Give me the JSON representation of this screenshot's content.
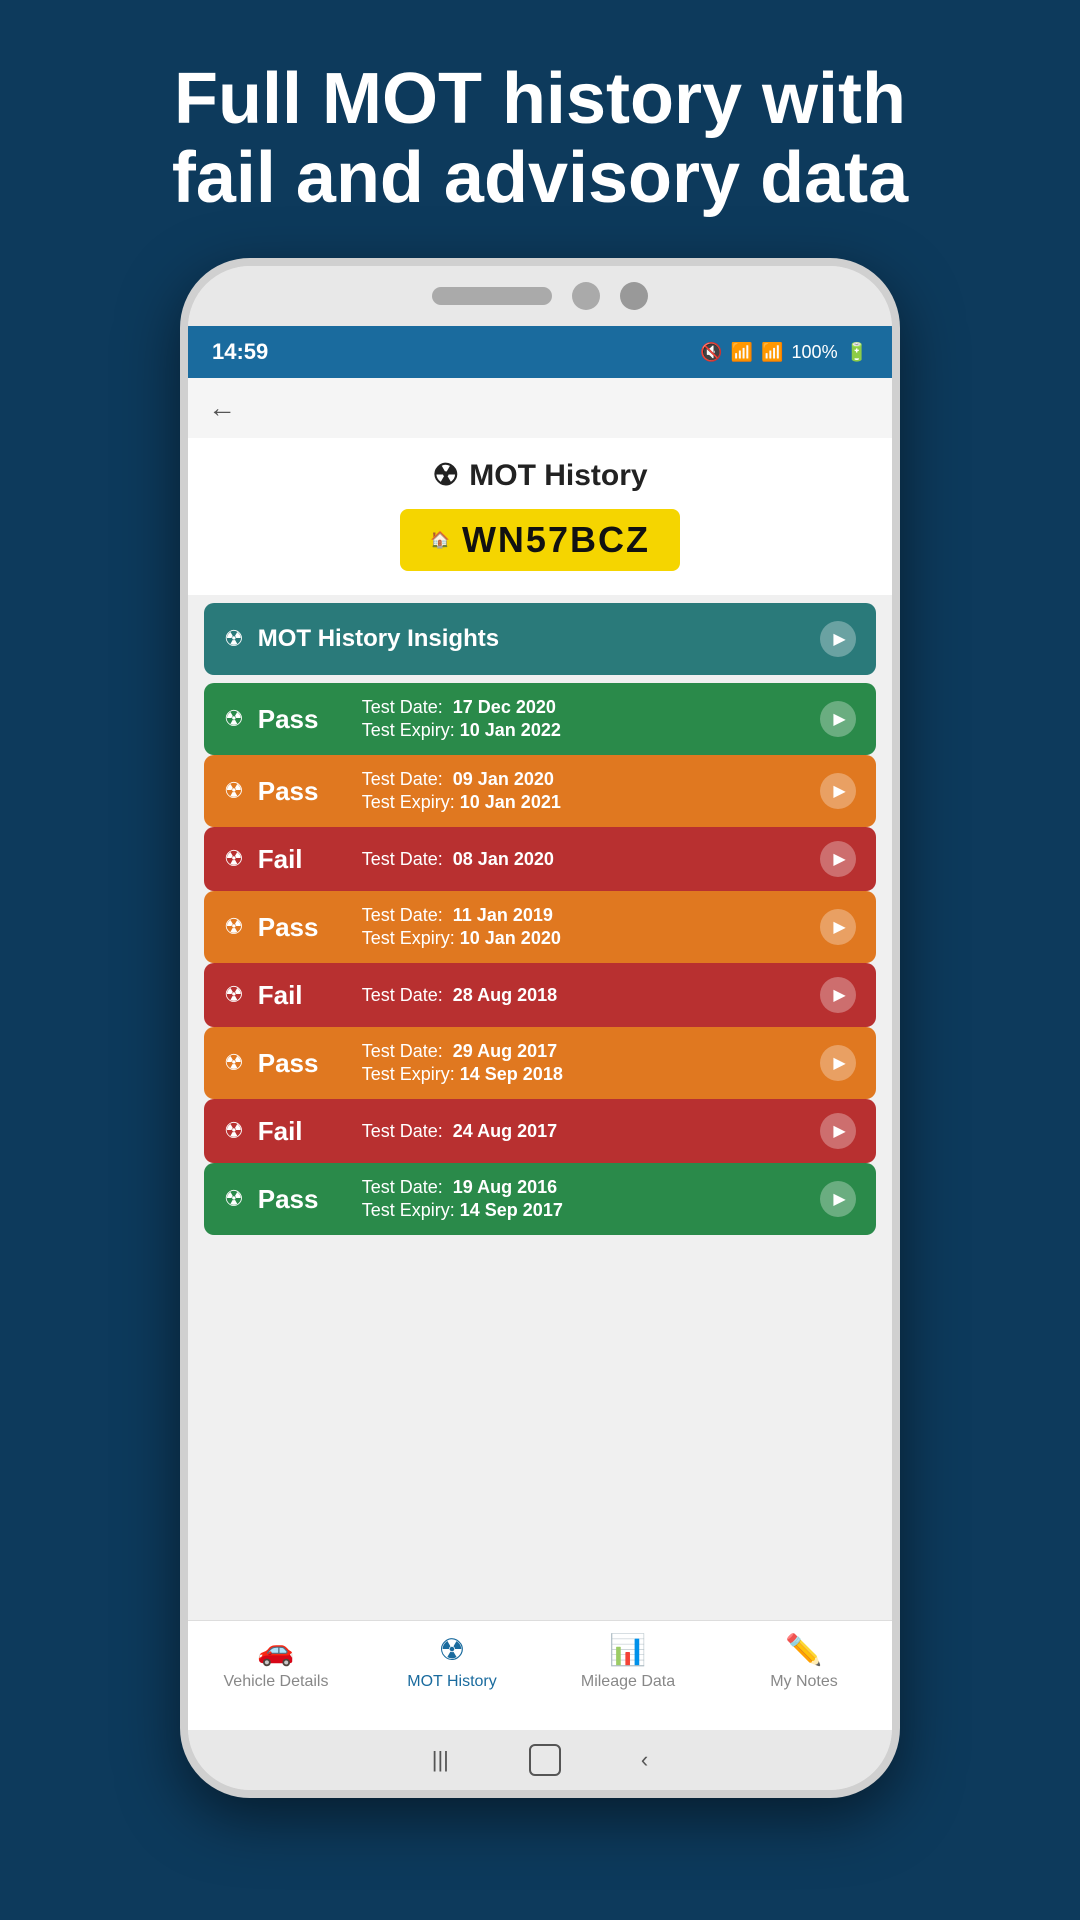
{
  "headline": {
    "line1": "Full MOT history with",
    "line2": "fail and advisory data"
  },
  "statusBar": {
    "time": "14:59",
    "battery": "100%"
  },
  "motHeader": {
    "title": "MOT History",
    "plate": "WN57BCZ"
  },
  "insightsRow": {
    "label": "MOT History Insights"
  },
  "motItems": [
    {
      "status": "Pass",
      "colorClass": "pass-green",
      "testDate": "17 Dec 2020",
      "testExpiry": "10 Jan 2022",
      "hasExpiry": true
    },
    {
      "status": "Pass",
      "colorClass": "pass-orange",
      "testDate": "09 Jan 2020",
      "testExpiry": "10 Jan 2021",
      "hasExpiry": true
    },
    {
      "status": "Fail",
      "colorClass": "fail-red",
      "testDate": "08 Jan 2020",
      "testExpiry": null,
      "hasExpiry": false
    },
    {
      "status": "Pass",
      "colorClass": "pass-orange",
      "testDate": "11 Jan 2019",
      "testExpiry": "10 Jan 2020",
      "hasExpiry": true
    },
    {
      "status": "Fail",
      "colorClass": "fail-red",
      "testDate": "28 Aug 2018",
      "testExpiry": null,
      "hasExpiry": false
    },
    {
      "status": "Pass",
      "colorClass": "pass-orange",
      "testDate": "29 Aug 2017",
      "testExpiry": "14 Sep 2018",
      "hasExpiry": true
    },
    {
      "status": "Fail",
      "colorClass": "fail-red",
      "testDate": "24 Aug 2017",
      "testExpiry": null,
      "hasExpiry": false
    },
    {
      "status": "Pass",
      "colorClass": "pass-green",
      "testDate": "19 Aug 2016",
      "testExpiry": "14 Sep 2017",
      "hasExpiry": true
    }
  ],
  "bottomNav": {
    "items": [
      {
        "label": "Vehicle Details",
        "icon": "🚗",
        "active": false
      },
      {
        "label": "MOT History",
        "icon": "☢",
        "active": true
      },
      {
        "label": "Mileage Data",
        "icon": "📊",
        "active": false
      },
      {
        "label": "My Notes",
        "icon": "✏️",
        "active": false
      }
    ]
  },
  "labels": {
    "testDate": "Test Date:",
    "testExpiry": "Test Expiry:"
  }
}
